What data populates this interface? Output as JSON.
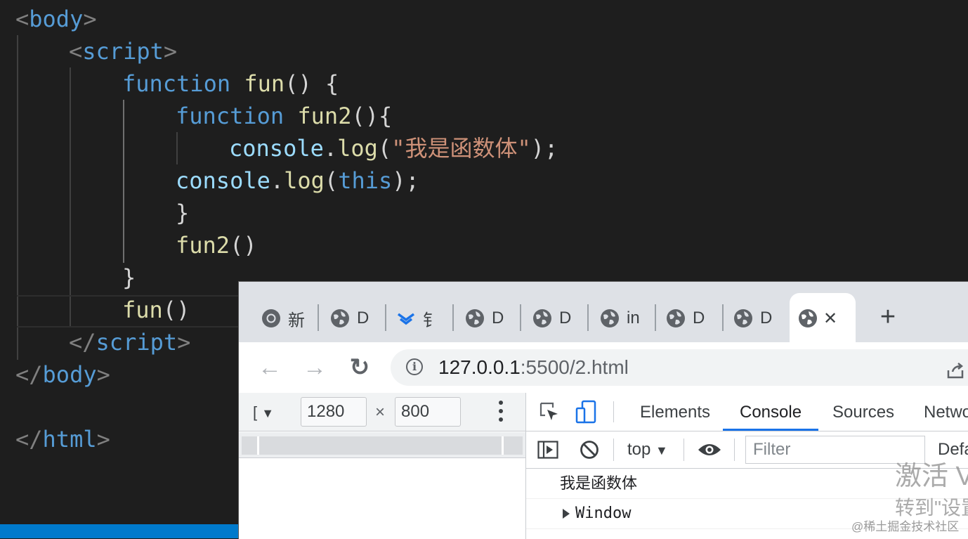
{
  "editor": {
    "lines": [
      {
        "open": "<",
        "tag": "body",
        "close": ">"
      },
      {
        "open": "<",
        "tag": "script",
        "close": ">"
      },
      {
        "kw": "function",
        "name": "fun",
        "rest": "() {"
      },
      {
        "kw": "function",
        "name": "fun2",
        "rest": "(){"
      },
      {
        "obj": "console",
        "dot": ".",
        "method": "log",
        "paren_open": "(",
        "str": "\"我是函数体\"",
        "paren_close": ");"
      },
      {
        "obj": "console",
        "dot": ".",
        "method": "log",
        "paren_open": "(",
        "this": "this",
        "paren_close": ");"
      },
      {
        "text": "}"
      },
      {
        "name": "fun2",
        "rest": "()"
      },
      {
        "text": "}"
      },
      {
        "name": "fun",
        "rest": "()"
      },
      {
        "open": "</",
        "tag": "script",
        "close": ">"
      },
      {
        "open": "</",
        "tag": "body",
        "close": ">"
      },
      {
        "open": "</",
        "tag": "html",
        "close": ">"
      }
    ]
  },
  "browser": {
    "tabs": [
      {
        "icon": "chrome-icon",
        "label": "新"
      },
      {
        "icon": "globe-icon",
        "label": "D"
      },
      {
        "icon": "dingtalk-doc-icon",
        "label": "钅"
      },
      {
        "icon": "globe-icon",
        "label": "D"
      },
      {
        "icon": "globe-icon",
        "label": "D"
      },
      {
        "icon": "globe-icon",
        "label": "in"
      },
      {
        "icon": "globe-icon",
        "label": "D"
      },
      {
        "icon": "globe-icon",
        "label": "D"
      }
    ],
    "active_tab": {
      "icon": "globe-icon",
      "close": "✕"
    },
    "new_tab": "+",
    "nav": {
      "back": "←",
      "forward": "→",
      "reload": "↻"
    },
    "url": {
      "host": "127.0.0.1",
      "rest": ":5500/2.html"
    },
    "info_icon": "i"
  },
  "device_toolbar": {
    "device_label": "[",
    "width": "1280",
    "height": "800",
    "times": "×"
  },
  "devtools": {
    "tabs": [
      "Elements",
      "Console",
      "Sources",
      "Netwo"
    ],
    "active_tab": "Console",
    "context": "top",
    "filter_placeholder": "Filter",
    "levels": "Defa",
    "messages": [
      {
        "text": "我是函数体",
        "mono": false,
        "expandable": false
      },
      {
        "text": "Window",
        "mono": true,
        "expandable": true
      }
    ],
    "accent": "#1a73e8"
  },
  "watermark": {
    "activate_line1": "激活 V",
    "activate_line2": "转到\"设置",
    "juejin": "@稀土掘金技术社区"
  }
}
